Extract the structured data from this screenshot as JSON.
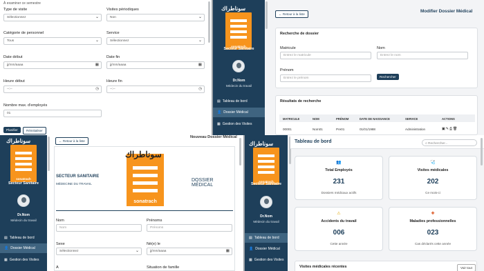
{
  "q1": {
    "top_note": "À examiner ce semestre",
    "type_visite": {
      "label": "Type de visite",
      "value": "Sélectionnez"
    },
    "visites_periodiques": {
      "label": "Visites périodiques",
      "value": "Non"
    },
    "categorie": {
      "label": "Catégorie de personnel",
      "value": "Tous"
    },
    "service": {
      "label": "Service",
      "value": "Sélectionnez"
    },
    "date_debut": {
      "label": "Date début",
      "value": "jj/mm/aaaa"
    },
    "date_fin": {
      "label": "Date fin",
      "value": "jj/mm/aaaa"
    },
    "heure_debut": {
      "label": "Heure début",
      "value": "--:--"
    },
    "heure_fin": {
      "label": "Heure fin",
      "value": "--:--"
    },
    "nb_max": {
      "label": "Nombre max. d'employés",
      "value": "01"
    },
    "planifier": "Planifier",
    "reinitialiser": "Réinitialiser"
  },
  "brand": {
    "arabic": "سوناطراك",
    "logo_text": "sonatrach",
    "sector": "Secteur Sanitaire",
    "user_name": "Dr.Nom",
    "user_role": "Médecin du travail",
    "orange": "#f7941d",
    "navy": "#1e3f5a"
  },
  "nav": [
    "Tableau de bord",
    "Dossier Médical",
    "Gestion des Visites"
  ],
  "q2": {
    "back": "← Retour à la liste",
    "title": "Modifier Dossier Médical",
    "search_title": "Recherche de dossier",
    "matricule": {
      "label": "Matricule",
      "placeholder": "Entrez le matricule"
    },
    "nom": {
      "label": "Nom",
      "placeholder": "Entrez le nom"
    },
    "prenom": {
      "label": "Prénom",
      "placeholder": "Entrez le prénom"
    },
    "search_btn": "Rechercher",
    "results_title": "Résultats de recherche",
    "columns": [
      "MATRICULE",
      "NOM",
      "PRÉNOM",
      "DATE DE NAISSANCE",
      "SERVICE",
      "ACTIONS"
    ],
    "row": [
      "00001",
      "Nom01",
      "Pre01",
      "01/01/1988",
      "Administration"
    ]
  },
  "q3": {
    "back": "← Retour à la liste",
    "title": "Nouveau Dossier Médical",
    "sector": "SECTEUR SANITAIRE",
    "sub": "MÉDECINE DU TRAVAIL",
    "doc": "DOSSIER MÉDICAL",
    "nom": {
      "label": "Nom",
      "placeholder": "Nom"
    },
    "prenom": {
      "label": "Prénoms",
      "placeholder": "Prénoms"
    },
    "sexe": {
      "label": "Sexe",
      "value": "Sélectionnez"
    },
    "ne": {
      "label": "Né(e) le",
      "value": "jj/mm/aaaa"
    },
    "situation": "Situation de famille",
    "a_label": "A"
  },
  "q4": {
    "title": "Tableau de bord",
    "search_placeholder": "Rechercher...",
    "stats": [
      {
        "title": "Total Employés",
        "value": "231",
        "sub": "Dossiers médicaux actifs",
        "icon": "👥",
        "color": "#2b6cb0"
      },
      {
        "title": "Visites médicales",
        "value": "202",
        "sub": "Ce mois-ci",
        "icon": "🩺",
        "color": "#2f9e44"
      },
      {
        "title": "Accidents du travail",
        "value": "006",
        "sub": "Cette année",
        "icon": "⚠",
        "color": "#e0a800"
      },
      {
        "title": "Maladies professionnelles",
        "value": "023",
        "sub": "Cas déclarés cette année",
        "icon": "✚",
        "color": "#d9480f"
      }
    ],
    "recent": "Visites médicales récentes",
    "voir_tout": "Voir tout"
  }
}
